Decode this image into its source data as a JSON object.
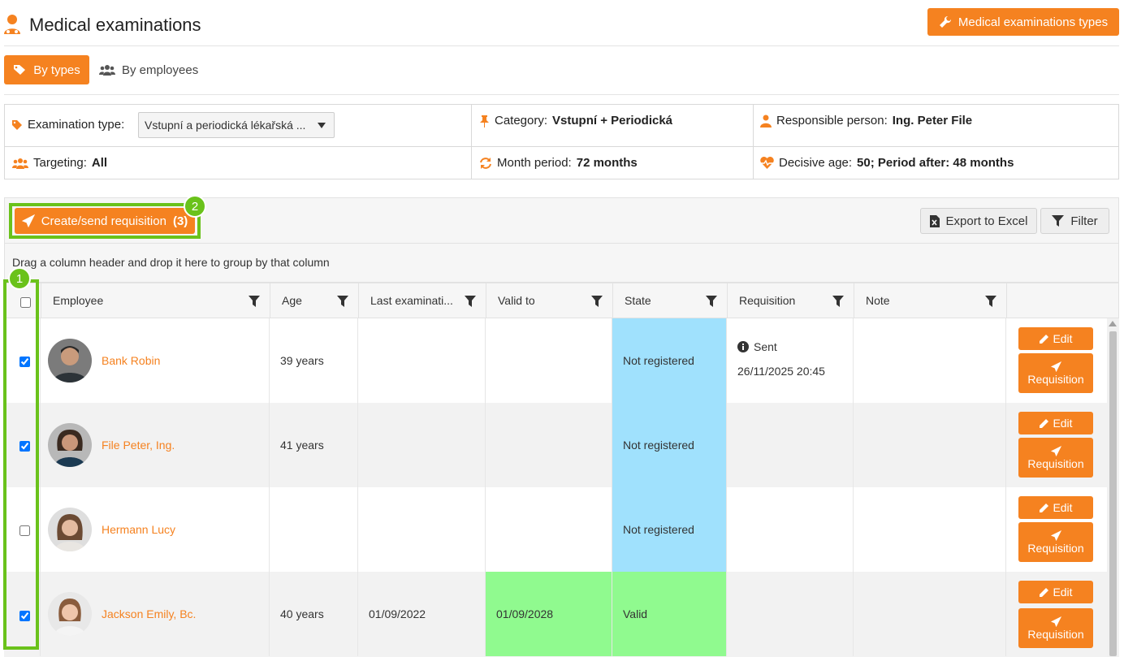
{
  "header": {
    "title": "Medical examinations",
    "types_button": "Medical examinations types"
  },
  "tabs": [
    {
      "label": "By types",
      "active": true
    },
    {
      "label": "By employees",
      "active": false
    }
  ],
  "info": {
    "exam_type_label": "Examination type:",
    "exam_type_value": "Vstupní a periodická lékařská ...",
    "category_label": "Category:",
    "category_value": "Vstupní + Periodická",
    "responsible_label": "Responsible person:",
    "responsible_value": "Ing. Peter File",
    "targeting_label": "Targeting:",
    "targeting_value": "All",
    "month_label": "Month period:",
    "month_value": "72 months",
    "age_label": "Decisive age:",
    "age_value": "50; Period after: 48 months"
  },
  "toolbar": {
    "send_label": "Create/send requisition",
    "send_count": "(3)",
    "export_label": "Export to Excel",
    "filter_label": "Filter",
    "callout_1": "1",
    "callout_2": "2"
  },
  "group_hint": "Drag a column header and drop it here to group by that column",
  "columns": [
    "Employee",
    "Age",
    "Last examinati...",
    "Valid to",
    "State",
    "Requisition",
    "Note"
  ],
  "rows": [
    {
      "checked": true,
      "name": "Bank Robin",
      "age": "39 years",
      "last": "",
      "valid_to": "",
      "state": "Not registered",
      "requisition_status": "Sent",
      "requisition_date": "26/11/2025 20:45",
      "note": ""
    },
    {
      "checked": true,
      "name": "File Peter, Ing.",
      "age": "41 years",
      "last": "",
      "valid_to": "",
      "state": "Not registered",
      "requisition_status": "",
      "requisition_date": "",
      "note": ""
    },
    {
      "checked": false,
      "name": "Hermann Lucy",
      "age": "",
      "last": "",
      "valid_to": "",
      "state": "Not registered",
      "requisition_status": "",
      "requisition_date": "",
      "note": ""
    },
    {
      "checked": true,
      "name": "Jackson Emily, Bc.",
      "age": "40 years",
      "last": "01/09/2022",
      "valid_to": "01/09/2028",
      "state": "Valid",
      "requisition_status": "",
      "requisition_date": "",
      "note": ""
    }
  ],
  "row_actions": {
    "edit": "Edit",
    "requisition": "Requisition"
  },
  "colors": {
    "accent": "#f58220",
    "not_registered": "#a0e1fd",
    "valid": "#90fa8f",
    "callout": "#6ac21b"
  }
}
